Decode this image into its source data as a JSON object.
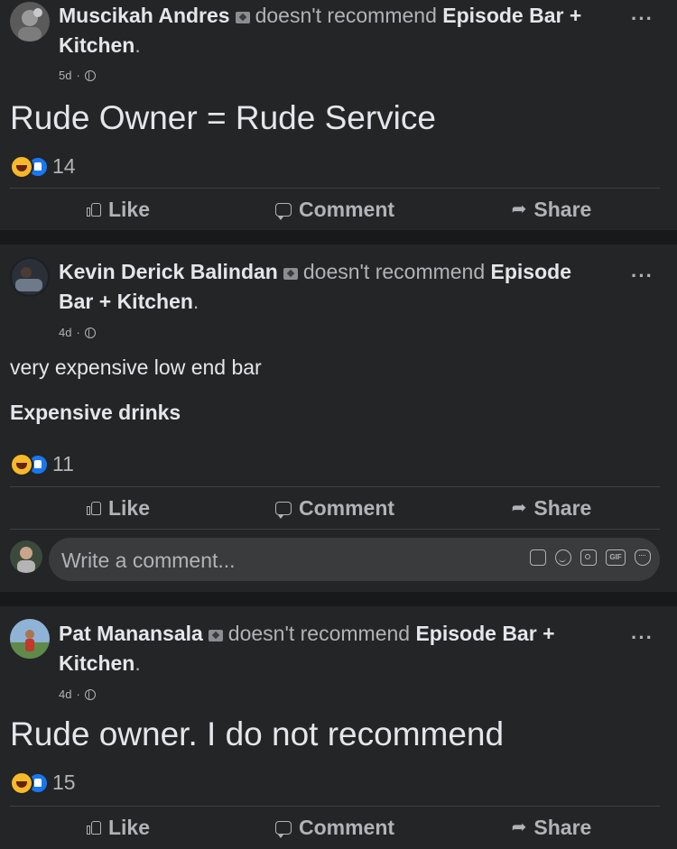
{
  "colors": {
    "page_bg": "#18191a",
    "card_bg": "#242526",
    "text_primary": "#e4e6eb",
    "text_secondary": "#b0b3b8",
    "like_blue": "#1877f2",
    "haha_yellow": "#f7b928"
  },
  "actions": {
    "like": "Like",
    "comment": "Comment",
    "share": "Share"
  },
  "more_label": "···",
  "posts": [
    {
      "author": "Muscikah Andres",
      "verb": "doesn't recommend",
      "place": "Episode Bar + Kitchen",
      "time": "5d",
      "separator": "·",
      "text": "Rude Owner = Rude Service",
      "reaction_count": "14",
      "reaction_icons": [
        "haha-reaction-icon",
        "like-reaction-icon"
      ]
    },
    {
      "author": "Kevin Derick Balindan",
      "verb": "doesn't recommend",
      "place": "Episode Bar + Kitchen",
      "time": "4d",
      "separator": "·",
      "text_line1": "very expensive low end  bar",
      "text_line2": "Expensive drinks",
      "reaction_count": "11",
      "reaction_icons": [
        "haha-reaction-icon",
        "like-reaction-icon"
      ],
      "comment_placeholder": "Write a comment...",
      "comment_tools": [
        "sticker-icon",
        "emoji-icon",
        "camera-icon",
        "gif-icon",
        "avatar-sticker-icon"
      ],
      "gif_label": "GIF"
    },
    {
      "author": "Pat Manansala",
      "verb": "doesn't recommend",
      "place": "Episode Bar + Kitchen",
      "time": "4d",
      "separator": "·",
      "text": "Rude owner. I do not recommend",
      "reaction_count": "15",
      "reaction_icons": [
        "haha-reaction-icon",
        "like-reaction-icon"
      ]
    }
  ]
}
